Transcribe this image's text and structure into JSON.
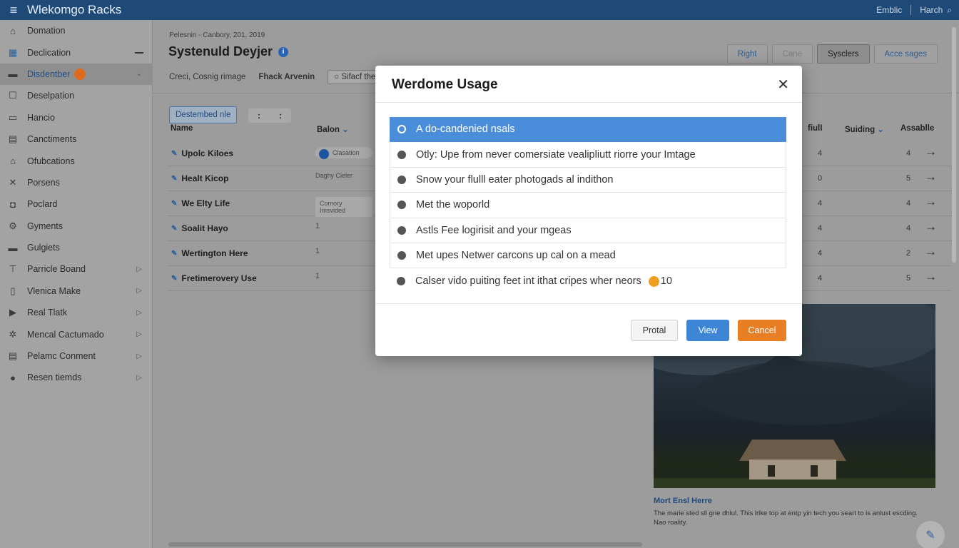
{
  "app": {
    "title": "Wlekomgo Racks",
    "top_right": [
      "Emblic",
      "Harch"
    ]
  },
  "sidebar": {
    "items": [
      {
        "label": "Domation",
        "icon": "home-icon"
      },
      {
        "label": "Declication",
        "icon": "grid-icon",
        "marker": "dash"
      },
      {
        "label": "Disdentber",
        "icon": "folder-icon",
        "active": true,
        "expanded": true
      },
      {
        "label": "Deselpation",
        "icon": "square-icon"
      },
      {
        "label": "Hancio",
        "icon": "chat-icon"
      },
      {
        "label": "Canctiments",
        "icon": "document-icon"
      },
      {
        "label": "Ofubcations",
        "icon": "lock-icon"
      },
      {
        "label": "Porsens",
        "icon": "close-icon"
      },
      {
        "label": "Poclard",
        "icon": "bag-icon"
      },
      {
        "label": "Gyments",
        "icon": "gear-icon"
      },
      {
        "label": "Gulgiets",
        "icon": "folder-icon"
      },
      {
        "label": "Parricle Boand",
        "icon": "tool-icon",
        "arrow": true
      },
      {
        "label": "Vlenica Make",
        "icon": "file-icon",
        "arrow": true
      },
      {
        "label": "Real Tlatk",
        "icon": "video-icon",
        "arrow": true
      },
      {
        "label": "Mencal Cactumado",
        "icon": "settings-icon",
        "arrow": true
      },
      {
        "label": "Pelamc Conment",
        "icon": "page-icon",
        "arrow": true
      },
      {
        "label": "Resen tiemds",
        "icon": "drop-icon",
        "arrow": true
      }
    ]
  },
  "main": {
    "breadcrumb": "Pelesnin - Canbory, 201, 2019",
    "title": "Systenuld Deyjer",
    "filters": {
      "a": "Creci, Cosnig rimage",
      "b": "Fhack Arvenin",
      "c": "Sifacf the"
    },
    "header_buttons": [
      "Right",
      "Cane",
      "Sysclers",
      "Acce sages"
    ],
    "table_tab": "Destembed nle",
    "columns": {
      "name": "Name",
      "status": "Balon",
      "c1": "fiulI",
      "c2": "Suiding",
      "c3": "Assablle"
    },
    "rows": [
      {
        "name": "Upolc Kiloes",
        "status": "Clasation",
        "v1": "4",
        "v2": "4"
      },
      {
        "name": "Healt Kicop",
        "status": "Daghy Cieler",
        "v1": "0",
        "v2": "5"
      },
      {
        "name": "We Elty Life",
        "status": "Comory Imsvided",
        "v1": "4",
        "v2": "4"
      },
      {
        "name": "Soalit Hayo",
        "status": "1",
        "v1": "4",
        "v2": "4"
      },
      {
        "name": "Wertington Here",
        "status": "1",
        "v1": "4",
        "v2": "2"
      },
      {
        "name": "Fretimerovery Use",
        "status": "1",
        "v1": "4",
        "v2": "5"
      }
    ],
    "card": {
      "title": "Mort Ensl Herre",
      "text": "The marie sted sll gne dhlul. This lrlke top at entp yin tech you seart to is anlust escding. Nao roality."
    }
  },
  "modal": {
    "title": "Werdome Usage",
    "options": [
      {
        "label": "A do-candenied nsals",
        "selected": true
      },
      {
        "label": "Otly: Upe from never comersiate vealipliutt riorre your Imtage"
      },
      {
        "label": "Snow your flulll eater photogads al indithon"
      },
      {
        "label": "Met the woporld"
      },
      {
        "label": "Astls Fee logirisit and your mgeas"
      },
      {
        "label": "Met upes Netwer carcons up cal on a mead"
      },
      {
        "label": "Calser vido puiting feet int ithat cripes wher neors",
        "badge": "10"
      }
    ],
    "buttons": {
      "ghost": "Protal",
      "primary": "View",
      "cancel": "Cancel"
    }
  },
  "colors": {
    "accent": "#4a8ddb",
    "topbar": "#1f4a78",
    "cancel": "#e97f24"
  }
}
